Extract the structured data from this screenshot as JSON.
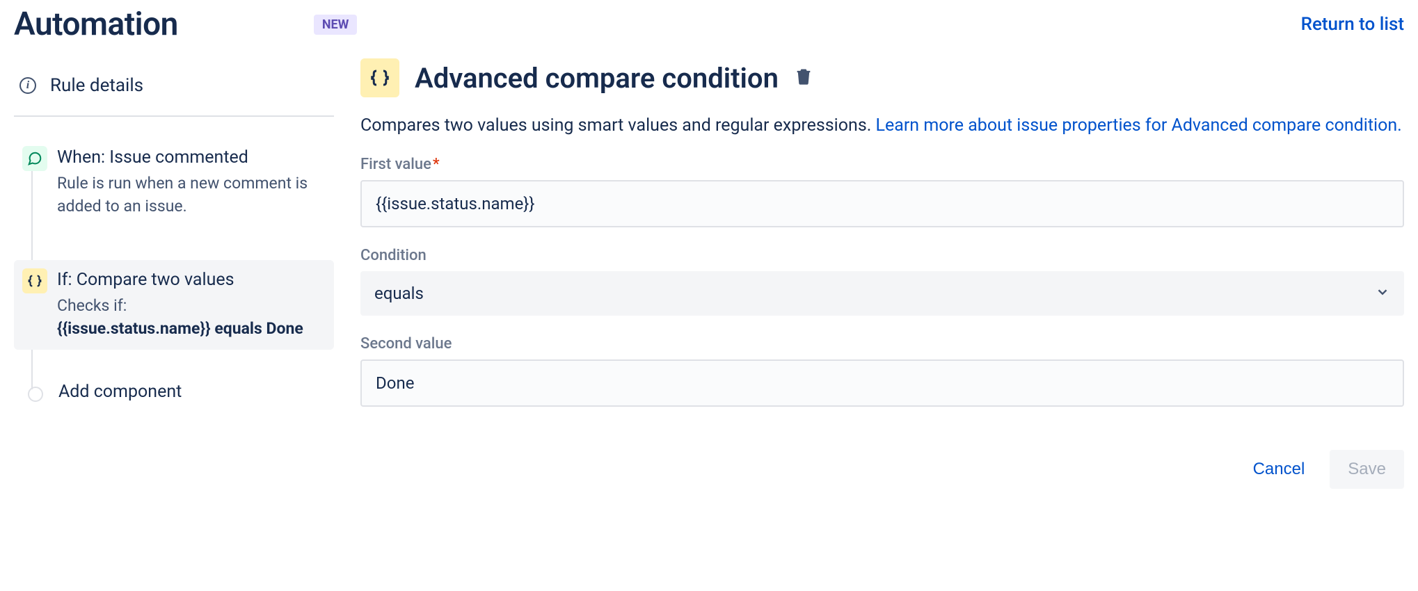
{
  "header": {
    "title": "Automation",
    "badge": "NEW",
    "return_link": "Return to list"
  },
  "sidebar": {
    "rule_details_label": "Rule details",
    "trigger": {
      "title": "When: Issue commented",
      "desc": "Rule is run when a new comment is added to an issue."
    },
    "condition": {
      "title": "If: Compare two values",
      "desc_prefix": "Checks if:",
      "desc_bold": "{{issue.status.name}} equals Done"
    },
    "add_component": "Add component"
  },
  "main": {
    "title": "Advanced compare condition",
    "desc_text": "Compares two values using smart values and regular expressions. ",
    "desc_link": "Learn more about issue properties for Advanced compare condition.",
    "first_value_label": "First value",
    "first_value": "{{issue.status.name}}",
    "condition_label": "Condition",
    "condition_value": "equals",
    "second_value_label": "Second value",
    "second_value": "Done",
    "cancel": "Cancel",
    "save": "Save"
  }
}
